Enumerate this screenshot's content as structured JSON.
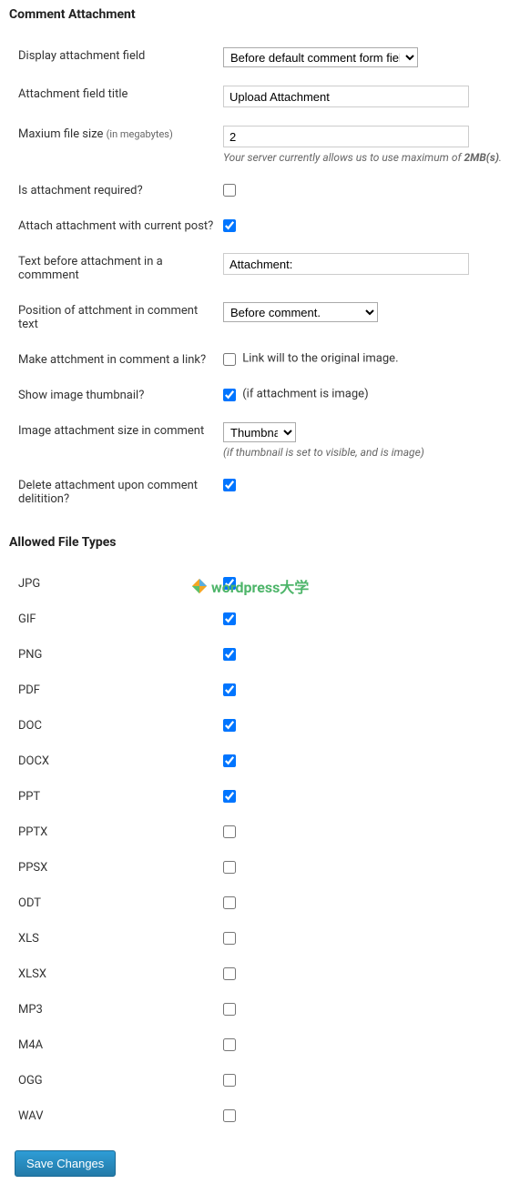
{
  "section1": {
    "heading": "Comment Attachment",
    "display_field": {
      "label": "Display attachment field",
      "value": "Before default comment form fields."
    },
    "title_field": {
      "label": "Attachment field title",
      "value": "Upload Attachment"
    },
    "max_size": {
      "label": "Maxium file size ",
      "sublabel": "(in megabytes)",
      "value": "2",
      "hint_prefix": "Your server currently allows us to use maximum of ",
      "hint_bold": "2MB(s)",
      "hint_suffix": "."
    },
    "required": {
      "label": "Is attachment required?",
      "checked": false
    },
    "attach_post": {
      "label": "Attach attachment with current post?",
      "checked": true
    },
    "text_before": {
      "label": "Text before attachment in a commment",
      "value": "Attachment:"
    },
    "position": {
      "label": "Position of attchment in comment text",
      "value": "Before comment."
    },
    "make_link": {
      "label": "Make attchment in comment a link?",
      "checked": false,
      "inline": "Link will to the original image."
    },
    "show_thumb": {
      "label": "Show image thumbnail?",
      "checked": true,
      "inline": "(if attachment is image)"
    },
    "img_size": {
      "label": "Image attachment size in comment",
      "value": "Thumbnail",
      "hint": "(if thumbnail is set to visible, and is image)"
    },
    "delete_on": {
      "label": "Delete attachment upon comment delitition?",
      "checked": true
    }
  },
  "section2": {
    "heading": "Allowed File Types",
    "types": [
      {
        "label": "JPG",
        "checked": true
      },
      {
        "label": "GIF",
        "checked": true
      },
      {
        "label": "PNG",
        "checked": true
      },
      {
        "label": "PDF",
        "checked": true
      },
      {
        "label": "DOC",
        "checked": true
      },
      {
        "label": "DOCX",
        "checked": true
      },
      {
        "label": "PPT",
        "checked": true
      },
      {
        "label": "PPTX",
        "checked": false
      },
      {
        "label": "PPSX",
        "checked": false
      },
      {
        "label": "ODT",
        "checked": false
      },
      {
        "label": "XLS",
        "checked": false
      },
      {
        "label": "XLSX",
        "checked": false
      },
      {
        "label": "MP3",
        "checked": false
      },
      {
        "label": "M4A",
        "checked": false
      },
      {
        "label": "OGG",
        "checked": false
      },
      {
        "label": "WAV",
        "checked": false
      }
    ]
  },
  "save_label": "Save Changes",
  "watermark": "wordpress大学"
}
